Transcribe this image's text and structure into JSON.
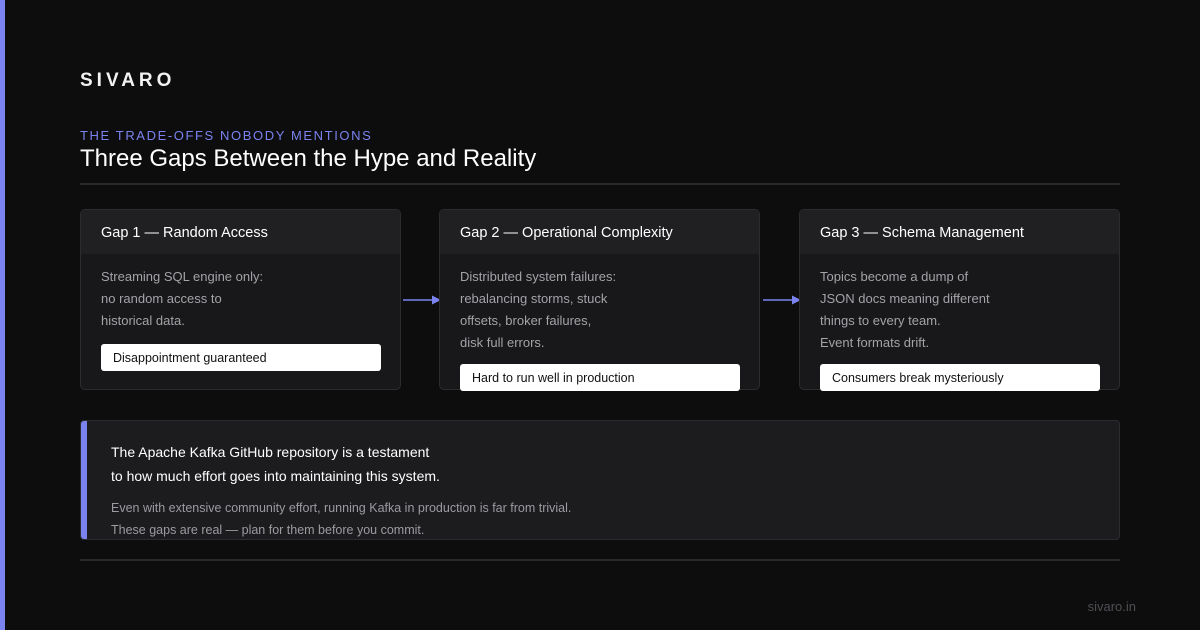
{
  "brand": "SIVARO",
  "eyebrow": "THE TRADE-OFFS NOBODY MENTIONS",
  "title": "Three Gaps Between the Hype and Reality",
  "colors": {
    "accent": "#7b83f0",
    "background": "#0d0d0d",
    "card": "#18181a"
  },
  "gaps": [
    {
      "title": "Gap 1 — Random Access",
      "lines": [
        "Streaming SQL engine only:",
        "no random access to",
        "historical data."
      ],
      "tag": "Disappointment guaranteed"
    },
    {
      "title": "Gap 2 — Operational Complexity",
      "lines": [
        "Distributed system failures:",
        "rebalancing storms, stuck",
        "offsets, broker failures,",
        "disk full errors."
      ],
      "tag": "Hard to run well in production"
    },
    {
      "title": "Gap 3 — Schema Management",
      "lines": [
        "Topics become a dump of",
        "JSON docs meaning different",
        "things to every team.",
        "Event formats drift."
      ],
      "tag": "Consumers break mysteriously"
    }
  ],
  "quote": {
    "line1": "The Apache Kafka GitHub repository is a testament",
    "line2": "to how much effort goes into maintaining this system.",
    "sub1": "Even with extensive community effort, running Kafka in production is far from trivial.",
    "sub2": "These gaps are real — plan for them before you commit."
  },
  "footer_url": "sivaro.in"
}
